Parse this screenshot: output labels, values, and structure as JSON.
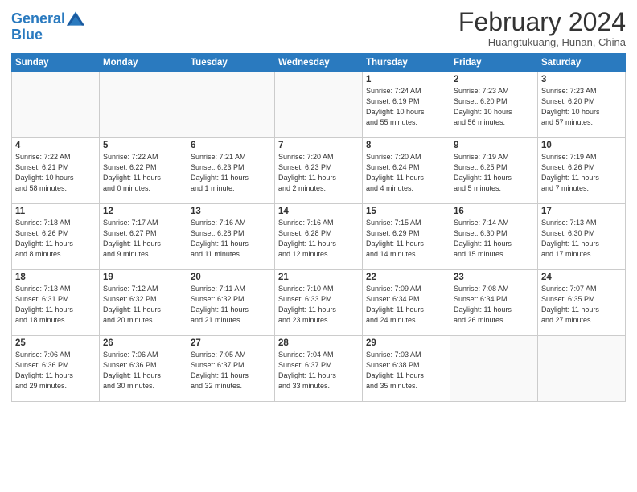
{
  "logo": {
    "line1": "General",
    "line2": "Blue"
  },
  "title": {
    "month_year": "February 2024",
    "location": "Huangtukuang, Hunan, China"
  },
  "days_of_week": [
    "Sunday",
    "Monday",
    "Tuesday",
    "Wednesday",
    "Thursday",
    "Friday",
    "Saturday"
  ],
  "weeks": [
    [
      {
        "day": "",
        "info": ""
      },
      {
        "day": "",
        "info": ""
      },
      {
        "day": "",
        "info": ""
      },
      {
        "day": "",
        "info": ""
      },
      {
        "day": "1",
        "info": "Sunrise: 7:24 AM\nSunset: 6:19 PM\nDaylight: 10 hours\nand 55 minutes."
      },
      {
        "day": "2",
        "info": "Sunrise: 7:23 AM\nSunset: 6:20 PM\nDaylight: 10 hours\nand 56 minutes."
      },
      {
        "day": "3",
        "info": "Sunrise: 7:23 AM\nSunset: 6:20 PM\nDaylight: 10 hours\nand 57 minutes."
      }
    ],
    [
      {
        "day": "4",
        "info": "Sunrise: 7:22 AM\nSunset: 6:21 PM\nDaylight: 10 hours\nand 58 minutes."
      },
      {
        "day": "5",
        "info": "Sunrise: 7:22 AM\nSunset: 6:22 PM\nDaylight: 11 hours\nand 0 minutes."
      },
      {
        "day": "6",
        "info": "Sunrise: 7:21 AM\nSunset: 6:23 PM\nDaylight: 11 hours\nand 1 minute."
      },
      {
        "day": "7",
        "info": "Sunrise: 7:20 AM\nSunset: 6:23 PM\nDaylight: 11 hours\nand 2 minutes."
      },
      {
        "day": "8",
        "info": "Sunrise: 7:20 AM\nSunset: 6:24 PM\nDaylight: 11 hours\nand 4 minutes."
      },
      {
        "day": "9",
        "info": "Sunrise: 7:19 AM\nSunset: 6:25 PM\nDaylight: 11 hours\nand 5 minutes."
      },
      {
        "day": "10",
        "info": "Sunrise: 7:19 AM\nSunset: 6:26 PM\nDaylight: 11 hours\nand 7 minutes."
      }
    ],
    [
      {
        "day": "11",
        "info": "Sunrise: 7:18 AM\nSunset: 6:26 PM\nDaylight: 11 hours\nand 8 minutes."
      },
      {
        "day": "12",
        "info": "Sunrise: 7:17 AM\nSunset: 6:27 PM\nDaylight: 11 hours\nand 9 minutes."
      },
      {
        "day": "13",
        "info": "Sunrise: 7:16 AM\nSunset: 6:28 PM\nDaylight: 11 hours\nand 11 minutes."
      },
      {
        "day": "14",
        "info": "Sunrise: 7:16 AM\nSunset: 6:28 PM\nDaylight: 11 hours\nand 12 minutes."
      },
      {
        "day": "15",
        "info": "Sunrise: 7:15 AM\nSunset: 6:29 PM\nDaylight: 11 hours\nand 14 minutes."
      },
      {
        "day": "16",
        "info": "Sunrise: 7:14 AM\nSunset: 6:30 PM\nDaylight: 11 hours\nand 15 minutes."
      },
      {
        "day": "17",
        "info": "Sunrise: 7:13 AM\nSunset: 6:30 PM\nDaylight: 11 hours\nand 17 minutes."
      }
    ],
    [
      {
        "day": "18",
        "info": "Sunrise: 7:13 AM\nSunset: 6:31 PM\nDaylight: 11 hours\nand 18 minutes."
      },
      {
        "day": "19",
        "info": "Sunrise: 7:12 AM\nSunset: 6:32 PM\nDaylight: 11 hours\nand 20 minutes."
      },
      {
        "day": "20",
        "info": "Sunrise: 7:11 AM\nSunset: 6:32 PM\nDaylight: 11 hours\nand 21 minutes."
      },
      {
        "day": "21",
        "info": "Sunrise: 7:10 AM\nSunset: 6:33 PM\nDaylight: 11 hours\nand 23 minutes."
      },
      {
        "day": "22",
        "info": "Sunrise: 7:09 AM\nSunset: 6:34 PM\nDaylight: 11 hours\nand 24 minutes."
      },
      {
        "day": "23",
        "info": "Sunrise: 7:08 AM\nSunset: 6:34 PM\nDaylight: 11 hours\nand 26 minutes."
      },
      {
        "day": "24",
        "info": "Sunrise: 7:07 AM\nSunset: 6:35 PM\nDaylight: 11 hours\nand 27 minutes."
      }
    ],
    [
      {
        "day": "25",
        "info": "Sunrise: 7:06 AM\nSunset: 6:36 PM\nDaylight: 11 hours\nand 29 minutes."
      },
      {
        "day": "26",
        "info": "Sunrise: 7:06 AM\nSunset: 6:36 PM\nDaylight: 11 hours\nand 30 minutes."
      },
      {
        "day": "27",
        "info": "Sunrise: 7:05 AM\nSunset: 6:37 PM\nDaylight: 11 hours\nand 32 minutes."
      },
      {
        "day": "28",
        "info": "Sunrise: 7:04 AM\nSunset: 6:37 PM\nDaylight: 11 hours\nand 33 minutes."
      },
      {
        "day": "29",
        "info": "Sunrise: 7:03 AM\nSunset: 6:38 PM\nDaylight: 11 hours\nand 35 minutes."
      },
      {
        "day": "",
        "info": ""
      },
      {
        "day": "",
        "info": ""
      }
    ]
  ]
}
